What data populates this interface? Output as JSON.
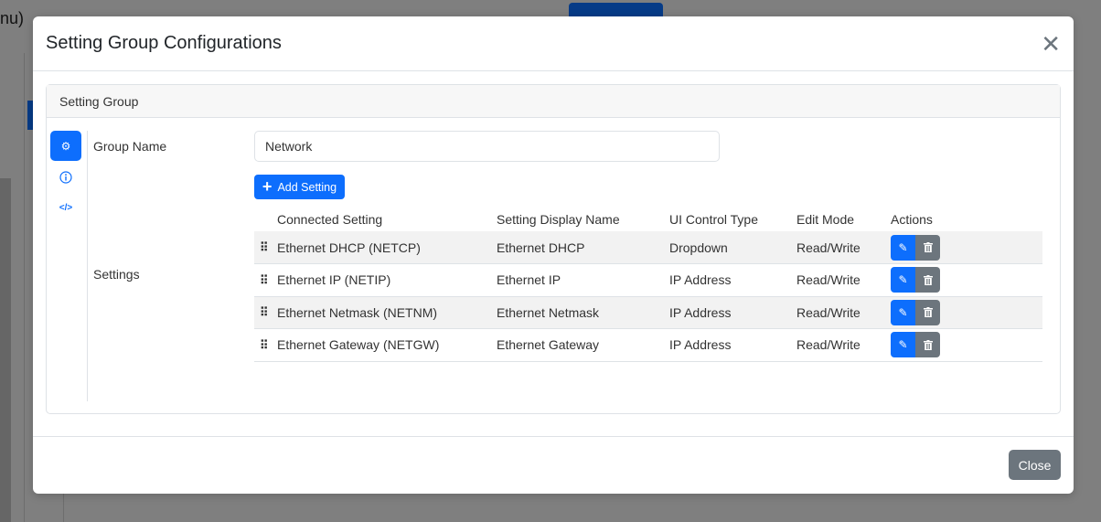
{
  "background": {
    "fragment": "nu)"
  },
  "modal": {
    "title": "Setting Group Configurations",
    "close_label": "Close"
  },
  "card": {
    "header": "Setting Group"
  },
  "nav": [
    {
      "icon": "gear-icon",
      "active": true
    },
    {
      "icon": "info-icon"
    },
    {
      "icon": "code-icon"
    }
  ],
  "form": {
    "group_name_label": "Group Name",
    "group_name_value": "Network",
    "settings_label": "Settings",
    "add_setting_label": "Add Setting"
  },
  "table": {
    "headers": [
      "Connected Setting",
      "Setting Display Name",
      "UI Control Type",
      "Edit Mode",
      "Actions"
    ],
    "rows": [
      {
        "connected": "Ethernet DHCP (NETCP)",
        "display": "Ethernet DHCP",
        "control": "Dropdown",
        "mode": "Read/Write"
      },
      {
        "connected": "Ethernet IP (NETIP)",
        "display": "Ethernet IP",
        "control": "IP Address",
        "mode": "Read/Write"
      },
      {
        "connected": "Ethernet Netmask (NETNM)",
        "display": "Ethernet Netmask",
        "control": "IP Address",
        "mode": "Read/Write"
      },
      {
        "connected": "Ethernet Gateway (NETGW)",
        "display": "Ethernet Gateway",
        "control": "IP Address",
        "mode": "Read/Write"
      }
    ]
  },
  "colors": {
    "primary": "#0d6efd",
    "secondary": "#6c757d"
  }
}
